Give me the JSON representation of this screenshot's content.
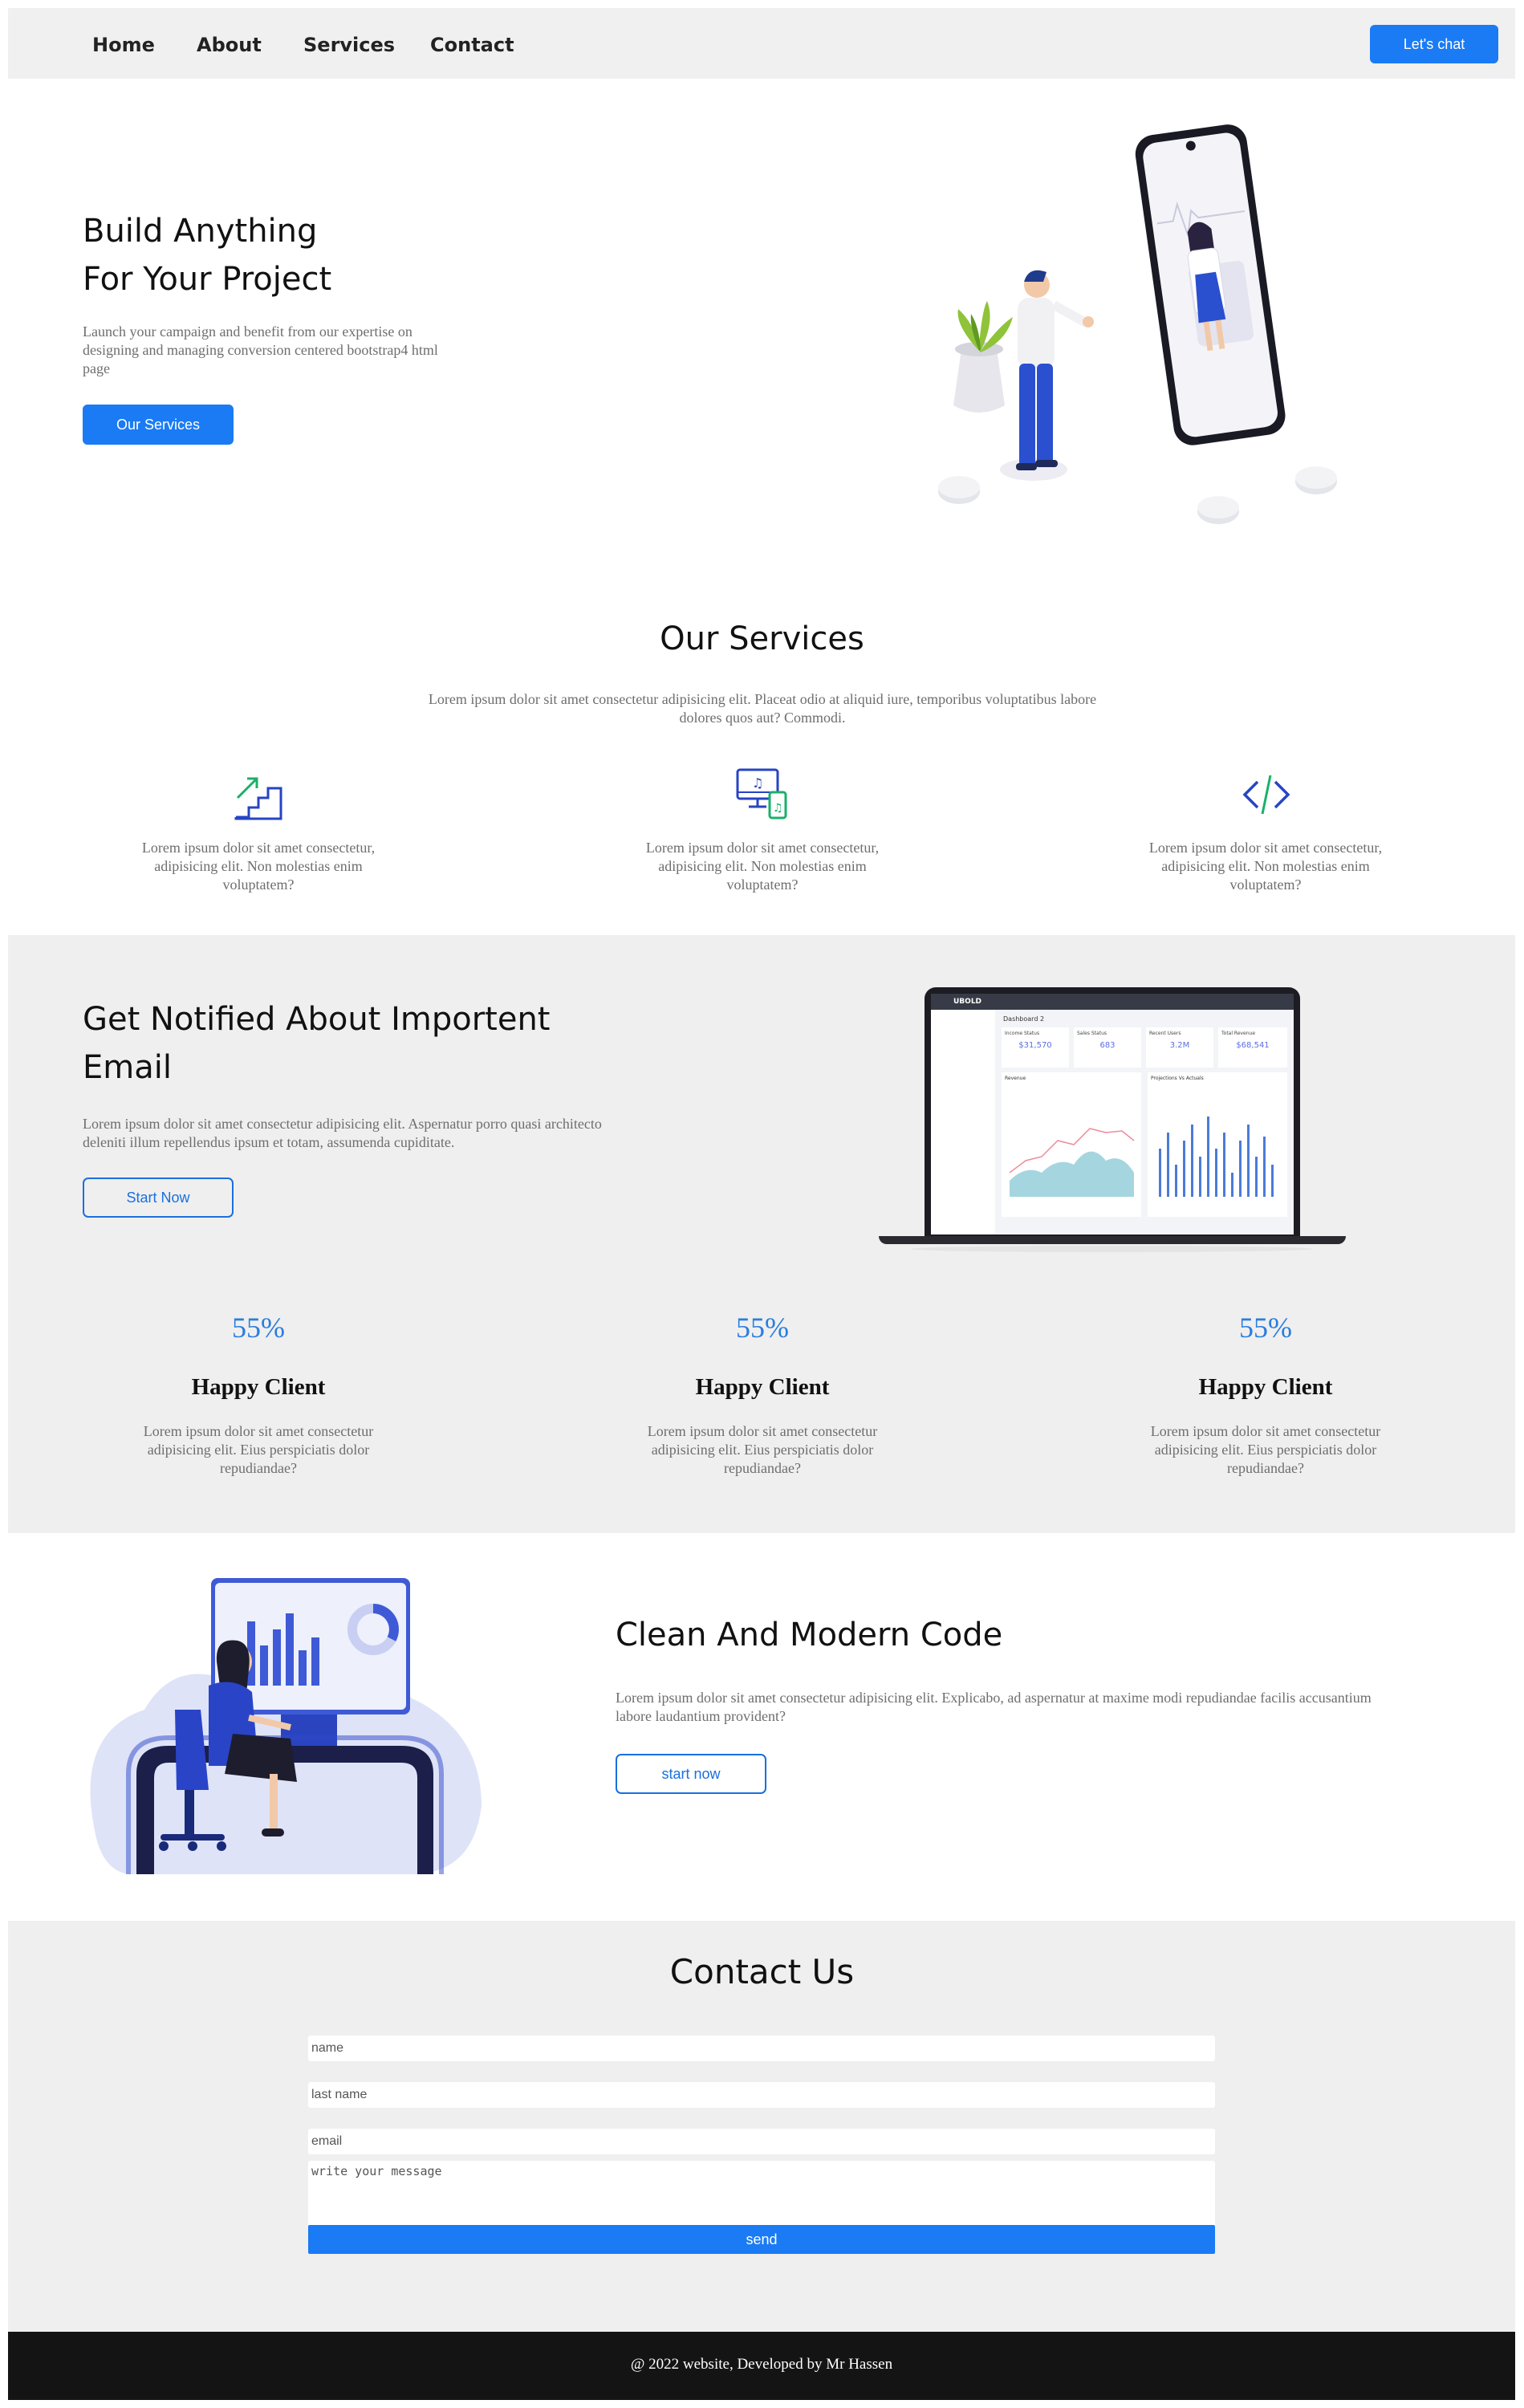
{
  "nav": {
    "links": [
      "Home",
      "About",
      "Services",
      "Contact"
    ],
    "cta_label": "Let's chat"
  },
  "hero": {
    "title_line1": "Build Anything",
    "title_line2": "For Your Project",
    "text": "Launch your campaign and benefit from our expertise on designing and managing conversion centered bootstrap4 html page",
    "button_label": "Our Services"
  },
  "services": {
    "title": "Our Services",
    "intro": "Lorem ipsum dolor sit amet consectetur adipisicing elit. Placeat odio at aliquid iure, temporibus voluptatibus labore dolores quos aut? Commodi.",
    "items": [
      {
        "icon": "stairs-growth-icon",
        "text": "Lorem ipsum dolor sit amet consectetur, adipisicing elit. Non molestias enim voluptatem?"
      },
      {
        "icon": "monitor-music-icon",
        "text": "Lorem ipsum dolor sit amet consectetur, adipisicing elit. Non molestias enim voluptatem?"
      },
      {
        "icon": "code-icon",
        "text": "Lorem ipsum dolor sit amet consectetur, adipisicing elit. Non molestias enim voluptatem?"
      }
    ]
  },
  "notify": {
    "title_line1": "Get Notified About Importent",
    "title_line2": "Email",
    "text": "Lorem ipsum dolor sit amet consectetur adipisicing elit. Aspernatur porro quasi architecto deleniti illum repellendus ipsum et totam, assumenda cupiditate.",
    "button_label": "Start Now",
    "dashboard": {
      "brand": "UBOLD",
      "heading": "Dashboard 2",
      "cards": [
        {
          "label": "Income Status",
          "value": "$31,570"
        },
        {
          "label": "Sales Status",
          "value": "683"
        },
        {
          "label": "Recent Users",
          "value": "3.2M"
        },
        {
          "label": "Total Revenue",
          "value": "$68,541"
        }
      ],
      "panel_left": "Revenue",
      "panel_right": "Projections Vs Actuals"
    }
  },
  "stats": [
    {
      "number": "55%",
      "title": "Happy Client",
      "text": "Lorem ipsum dolor sit amet consectetur adipisicing elit. Eius perspiciatis dolor repudiandae?"
    },
    {
      "number": "55%",
      "title": "Happy Client",
      "text": "Lorem ipsum dolor sit amet consectetur adipisicing elit. Eius perspiciatis dolor repudiandae?"
    },
    {
      "number": "55%",
      "title": "Happy Client",
      "text": "Lorem ipsum dolor sit amet consectetur adipisicing elit. Eius perspiciatis dolor repudiandae?"
    }
  ],
  "code": {
    "title": "Clean And Modern Code",
    "text": "Lorem ipsum dolor sit amet consectetur adipisicing elit. Explicabo, ad aspernatur at maxime modi repudiandae facilis accusantium labore laudantium provident?",
    "button_label": "start now"
  },
  "contact": {
    "title": "Contact Us",
    "name_placeholder": "name",
    "lastname_placeholder": "last name",
    "email_placeholder": "email",
    "message_placeholder": "write your message",
    "send_label": "send"
  },
  "footer": {
    "text": "@ 2022 website, Developed by Mr Hassen"
  },
  "colors": {
    "accent": "#1a7bf5",
    "band": "#efefef",
    "footer": "#141414"
  }
}
